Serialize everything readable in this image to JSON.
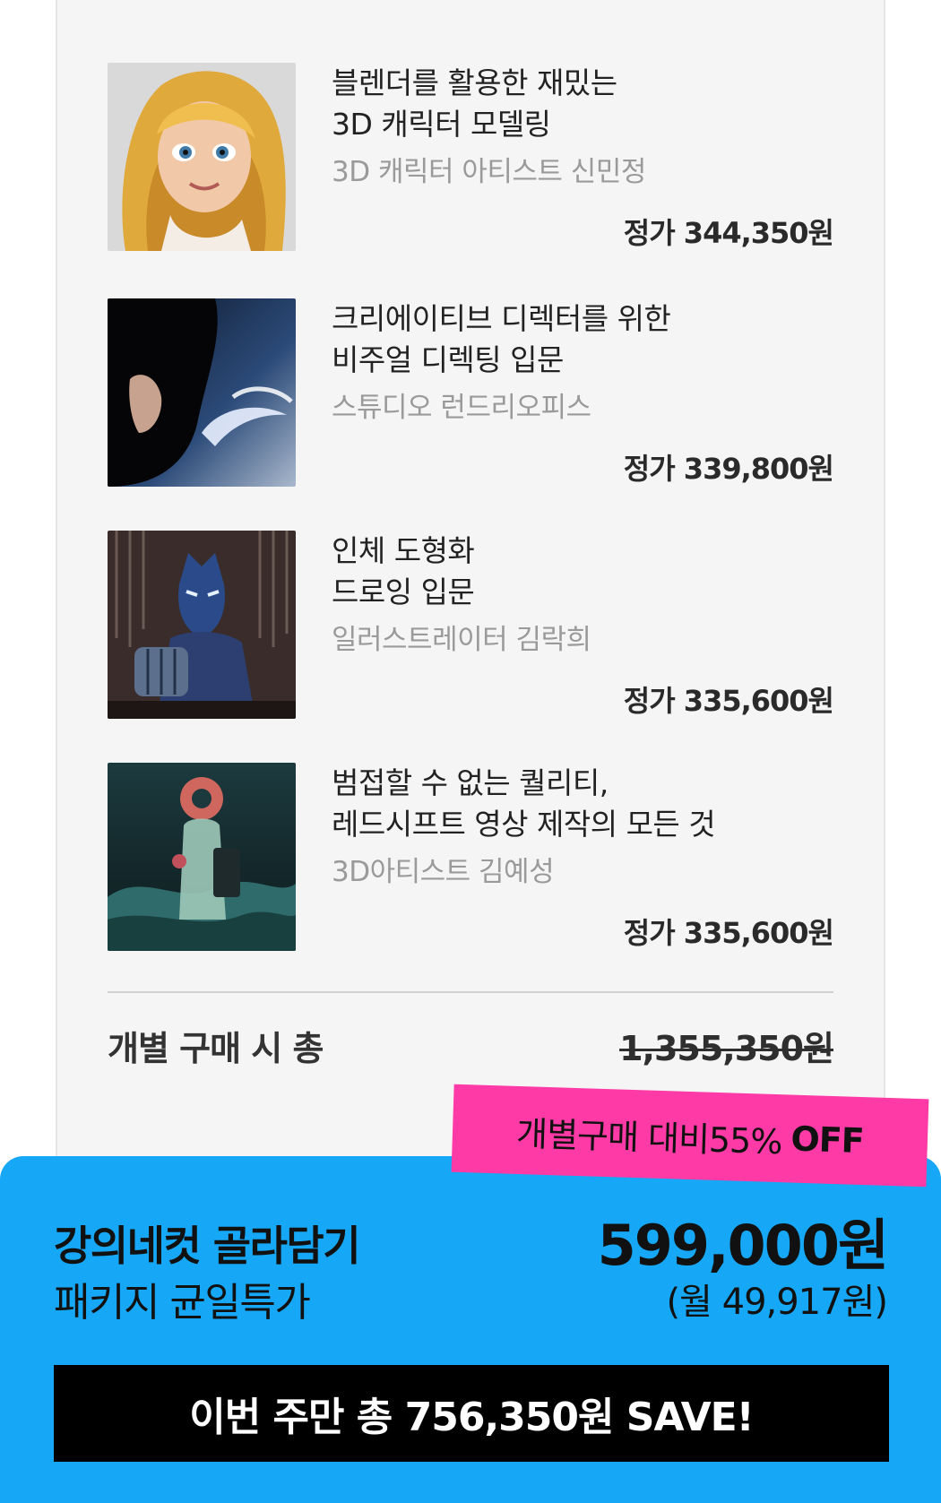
{
  "courses": [
    {
      "title_lines": [
        "블렌더를 활용한 재밌는",
        "3D 캐릭터 모델링"
      ],
      "author": "3D 캐릭터 아티스트 신민정",
      "price": "정가 344,350원"
    },
    {
      "title_lines": [
        "크리에이티브 디렉터를 위한",
        "비주얼 디렉팅 입문"
      ],
      "author": "스튜디오 런드리오피스",
      "price": "정가 339,800원"
    },
    {
      "title_lines": [
        "인체 도형화",
        "드로잉 입문"
      ],
      "author": "일러스트레이터 김락희",
      "price": "정가 335,600원"
    },
    {
      "title_lines": [
        "범접할 수 없는 퀄리티,",
        "레드시프트 영상 제작의 모든 것"
      ],
      "author": "3D아티스트 김예성",
      "price": "정가 335,600원"
    }
  ],
  "summary": {
    "label": "개별 구매 시 총",
    "original_total": "1,355,350원"
  },
  "discount_badge": {
    "text": "개별구매 대비55%",
    "emphasis": "OFF",
    "color": "#fe3aa6"
  },
  "package": {
    "title": "강의네컷 골라담기",
    "subtitle": "패키지 균일특가",
    "price": "599,000원",
    "monthly": "(월 49,917원)",
    "panel_color": "#16a8f6"
  },
  "save_banner": {
    "text": "이번 주만 총 756,350원 SAVE!"
  }
}
